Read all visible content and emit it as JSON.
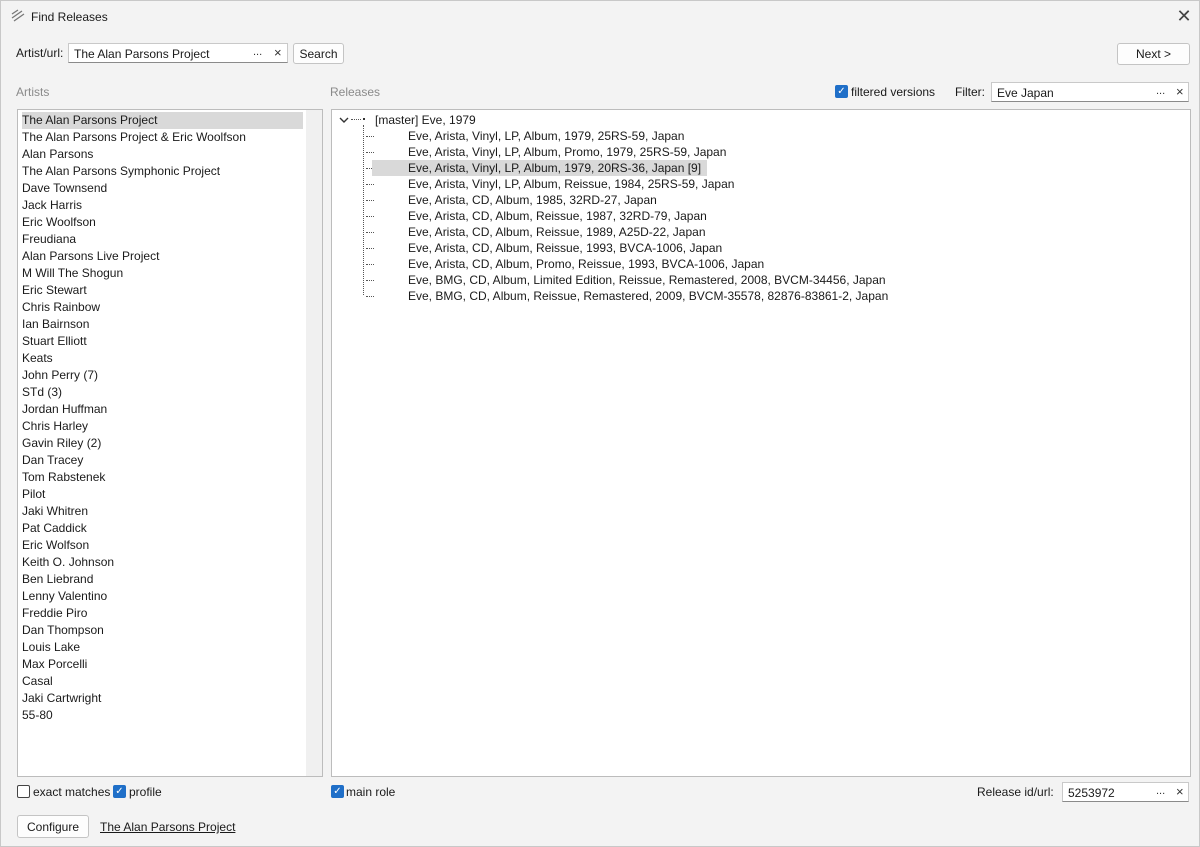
{
  "window": {
    "title": "Find Releases"
  },
  "search": {
    "label": "Artist/url:",
    "value": "The Alan Parsons Project",
    "button": "Search",
    "next_button": "Next  >"
  },
  "artists": {
    "header": "Artists",
    "items": [
      "The Alan Parsons Project",
      "The Alan Parsons Project & Eric Woolfson",
      "Alan Parsons",
      "The Alan Parsons Symphonic Project",
      "Dave Townsend",
      "Jack Harris",
      "Eric Woolfson",
      "Freudiana",
      "Alan Parsons Live Project",
      "M Will The Shogun",
      "Eric Stewart",
      "Chris Rainbow",
      "Ian Bairnson",
      "Stuart Elliott",
      "Keats",
      "John Perry (7)",
      "STd (3)",
      "Jordan Huffman",
      "Chris Harley",
      "Gavin Riley (2)",
      "Dan Tracey",
      "Tom Rabstenek",
      "Pilot",
      "Jaki Whitren",
      "Pat Caddick",
      "Eric Wolfson",
      "Keith O. Johnson",
      "Ben Liebrand",
      "Lenny Valentino",
      "Freddie Piro",
      "Dan Thompson",
      "Louis Lake",
      "Max Porcelli",
      "Casal",
      "Jaki Cartwright",
      "55-80"
    ],
    "selected": "The Alan Parsons Project"
  },
  "releases": {
    "header": "Releases",
    "filtered_versions_label": "filtered versions",
    "filter_label": "Filter:",
    "filter_value": "Eve Japan",
    "master": "[master] Eve, 1979",
    "items": [
      "Eve, Arista, Vinyl, LP, Album, 1979, 25RS-59, Japan",
      "Eve, Arista, Vinyl, LP, Album, Promo, 1979, 25RS-59, Japan",
      "Eve, Arista, Vinyl, LP, Album, 1979, 20RS-36, Japan [9]",
      "Eve, Arista, Vinyl, LP, Album, Reissue, 1984, 25RS-59, Japan",
      "Eve, Arista, CD, Album, 1985, 32RD-27, Japan",
      "Eve, Arista, CD, Album, Reissue, 1987, 32RD-79, Japan",
      "Eve, Arista, CD, Album, Reissue, 1989, A25D-22, Japan",
      "Eve, Arista, CD, Album, Reissue, 1993, BVCA-1006, Japan",
      "Eve, Arista, CD, Album, Promo, Reissue, 1993, BVCA-1006, Japan",
      "Eve, BMG, CD, Album, Limited Edition, Reissue, Remastered, 2008, BVCM-34456, Japan",
      "Eve, BMG, CD, Album, Reissue, Remastered, 2009, BVCM-35578, 82876-83861-2, Japan"
    ],
    "selected_index": 2
  },
  "options": {
    "exact_matches": "exact matches",
    "profile": "profile",
    "main_role": "main role",
    "release_id_label": "Release id/url:",
    "release_id_value": "5253972"
  },
  "footer": {
    "configure": "Configure",
    "artist_link": "The Alan Parsons Project"
  },
  "colors": {
    "accent": "#1f6fc8",
    "selection": "#d9d9d9"
  }
}
